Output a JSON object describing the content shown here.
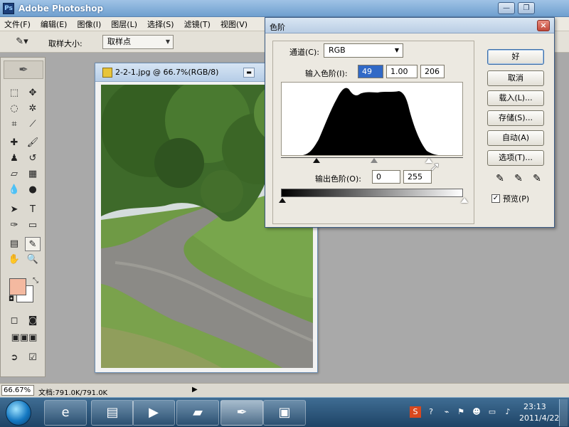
{
  "app": {
    "title": "Adobe Photoshop",
    "minimize_icon": "minimize-icon",
    "close_icon": "close-icon"
  },
  "menu": [
    "文件(F)",
    "编辑(E)",
    "图像(I)",
    "图层(L)",
    "选择(S)",
    "滤镜(T)",
    "视图(V)"
  ],
  "options_bar": {
    "sample_size_label": "取样大小:",
    "sample_size_value": "取样点"
  },
  "document": {
    "title": "2-2-1.jpg @ 66.7%(RGB/8)"
  },
  "levels_dialog": {
    "title": "色阶",
    "channel_label": "通道(C):",
    "channel_value": "RGB",
    "input_levels_label": "输入色阶(I):",
    "input_black": "49",
    "input_gamma": "1.00",
    "input_white": "206",
    "output_levels_label": "输出色阶(O):",
    "output_black": "0",
    "output_white": "255",
    "buttons": {
      "ok": "好",
      "cancel": "取消",
      "load": "载入(L)...",
      "save": "存储(S)...",
      "auto": "自动(A)",
      "options": "选项(T)..."
    },
    "preview_label": "预览(P)",
    "preview_checked": true
  },
  "status_bar": {
    "zoom": "66.67%",
    "doc_info": "文档:791.0K/791.0K"
  },
  "taskbar": {
    "time": "23:13",
    "date": "2011/4/22"
  },
  "colors": {
    "foreground": "#f4b9a0",
    "background": "#ffffff",
    "accent": "#3169c6"
  }
}
